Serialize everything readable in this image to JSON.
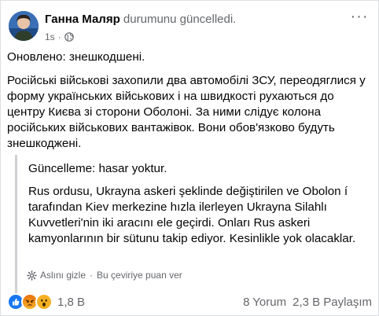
{
  "post": {
    "author": "Ганна Маляр",
    "action": "durumunu güncelledi.",
    "time": "1s",
    "dot": "·",
    "more": "···",
    "update_line": "Оновлено: знешкодшені.",
    "body": "Російські військові захопили два автомобілі ЗСУ, переодяглися у форму українських військових і на швидкості рухаються до центру Києва зі сторони Оболоні. За ними слідує колона російських військових вантажівок. Вони обов'язково будуть знешкоджені."
  },
  "translation": {
    "update_line": "Güncelleme: hasar yoktur.",
    "body": "Rus ordusu, Ukrayna askeri şeklinde değiştirilen ve Obolon í tarafından Kiev merkezine hızla ilerleyen Ukrayna Silahlı Kuvvetleri'nin iki aracını ele geçirdi. Onları Rus askeri kamyonlarının bir sütunu takip ediyor. Kesinlikle yok olacaklar.",
    "hide_original": "Aslını gizle",
    "dot": "·",
    "rate_translation": "Bu çeviriye puan ver"
  },
  "footer": {
    "reaction_count": "1,8 B",
    "comments": "8 Yorum",
    "shares": "2,3 B Paylaşım"
  },
  "icons": {
    "privacy": "globe-icon",
    "translation_settings": "gear-icon",
    "reactions": [
      "like-icon",
      "angry-icon",
      "wow-icon"
    ]
  },
  "colors": {
    "link_gray": "#65676b",
    "like_blue": "#1877f2",
    "angry_orange": "#e9710f",
    "wow_yellow": "#f7b125"
  }
}
